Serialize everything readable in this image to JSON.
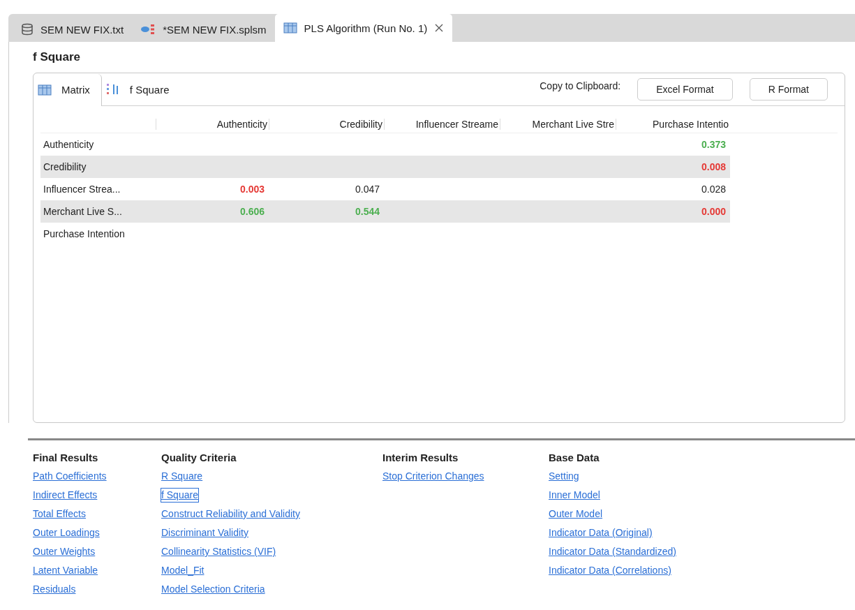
{
  "editor_tabs": [
    {
      "label": "SEM NEW FIX.txt",
      "kind": "database",
      "selected": false
    },
    {
      "label": "*SEM NEW FIX.splsm",
      "kind": "model",
      "selected": false
    },
    {
      "label": "PLS Algorithm (Run No. 1)",
      "kind": "table",
      "selected": true
    }
  ],
  "title": "f Square",
  "view_tabs": [
    {
      "label": "Matrix",
      "kind": "table",
      "selected": true
    },
    {
      "label": "f Square",
      "kind": "chart",
      "selected": false
    }
  ],
  "clipboard": {
    "label": "Copy to Clipboard:",
    "buttons": [
      "Excel Format",
      "R Format"
    ]
  },
  "table": {
    "columns": [
      "Authenticity",
      "Credibility",
      "Influencer Streame",
      "Merchant Live Stre",
      "Purchase Intentio"
    ],
    "rows": [
      {
        "label": "Authenticity",
        "cells": [
          null,
          null,
          null,
          null,
          {
            "value": "0.373",
            "color": "#4caf50"
          }
        ]
      },
      {
        "label": "Credibility",
        "cells": [
          null,
          null,
          null,
          null,
          {
            "value": "0.008",
            "color": "#e53935"
          }
        ]
      },
      {
        "label": "Influencer Strea...",
        "cells": [
          {
            "value": "0.003",
            "color": "#e53935"
          },
          {
            "value": "0.047",
            "color": "#222222"
          },
          null,
          null,
          {
            "value": "0.028",
            "color": "#222222"
          }
        ]
      },
      {
        "label": "Merchant Live S...",
        "cells": [
          {
            "value": "0.606",
            "color": "#4caf50"
          },
          {
            "value": "0.544",
            "color": "#4caf50"
          },
          null,
          null,
          {
            "value": "0.000",
            "color": "#e53935"
          }
        ]
      },
      {
        "label": "Purchase Intention",
        "cells": [
          null,
          null,
          null,
          null,
          null
        ]
      }
    ]
  },
  "result_groups": [
    {
      "heading": "Final Results",
      "links": [
        {
          "label": "Path Coefficients",
          "selected": false
        },
        {
          "label": "Indirect Effects",
          "selected": false
        },
        {
          "label": "Total Effects",
          "selected": false
        },
        {
          "label": "Outer Loadings",
          "selected": false
        },
        {
          "label": "Outer Weights",
          "selected": false
        },
        {
          "label": "Latent Variable",
          "selected": false
        },
        {
          "label": "Residuals",
          "selected": false
        }
      ]
    },
    {
      "heading": "Quality Criteria",
      "links": [
        {
          "label": "R Square",
          "selected": false
        },
        {
          "label": "f Square",
          "selected": true
        },
        {
          "label": "Construct Reliability and Validity",
          "selected": false
        },
        {
          "label": "Discriminant Validity",
          "selected": false
        },
        {
          "label": "Collinearity Statistics (VIF)",
          "selected": false
        },
        {
          "label": "Model_Fit",
          "selected": false
        },
        {
          "label": "Model Selection Criteria",
          "selected": false
        }
      ]
    },
    {
      "heading": "Interim Results",
      "links": [
        {
          "label": "Stop Criterion Changes",
          "selected": false
        }
      ]
    },
    {
      "heading": "Base Data",
      "links": [
        {
          "label": "Setting",
          "selected": false
        },
        {
          "label": "Inner Model",
          "selected": false
        },
        {
          "label": "Outer Model",
          "selected": false
        },
        {
          "label": "Indicator Data (Original)",
          "selected": false
        },
        {
          "label": "Indicator Data (Standardized)",
          "selected": false
        },
        {
          "label": "Indicator Data (Correlations)",
          "selected": false
        }
      ]
    }
  ]
}
